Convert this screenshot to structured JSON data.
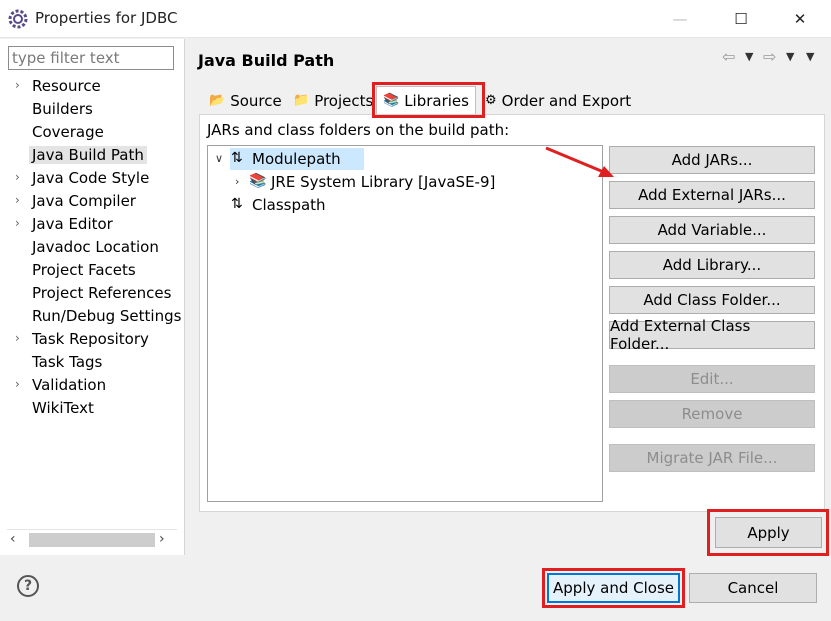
{
  "window": {
    "title": "Properties for JDBC",
    "controls": {
      "minimize": "—",
      "maximize": "☐",
      "close": "✕"
    }
  },
  "sidebar": {
    "filter_placeholder": "type filter text",
    "items": [
      {
        "label": "Resource",
        "expandable": true
      },
      {
        "label": "Builders",
        "expandable": false
      },
      {
        "label": "Coverage",
        "expandable": false
      },
      {
        "label": "Java Build Path",
        "expandable": false,
        "selected": true
      },
      {
        "label": "Java Code Style",
        "expandable": true
      },
      {
        "label": "Java Compiler",
        "expandable": true
      },
      {
        "label": "Java Editor",
        "expandable": true
      },
      {
        "label": "Javadoc Location",
        "expandable": false
      },
      {
        "label": "Project Facets",
        "expandable": false
      },
      {
        "label": "Project References",
        "expandable": false
      },
      {
        "label": "Run/Debug Settings",
        "expandable": false
      },
      {
        "label": "Task Repository",
        "expandable": true
      },
      {
        "label": "Task Tags",
        "expandable": false
      },
      {
        "label": "Validation",
        "expandable": true
      },
      {
        "label": "WikiText",
        "expandable": false
      }
    ]
  },
  "page": {
    "title": "Java Build Path",
    "tabs": [
      {
        "label": "Source",
        "icon": "source-folder-icon"
      },
      {
        "label": "Projects",
        "icon": "projects-icon"
      },
      {
        "label": "Libraries",
        "icon": "libraries-icon",
        "active": true
      },
      {
        "label": "Order and Export",
        "icon": "order-export-icon"
      }
    ],
    "content_label": "JARs and class folders on the build path:",
    "tree": {
      "modulepath": "Modulepath",
      "jre": "JRE System Library [JavaSE-9]",
      "classpath": "Classpath"
    },
    "buttons": {
      "add_jars": "Add JARs...",
      "add_external_jars": "Add External JARs...",
      "add_variable": "Add Variable...",
      "add_library": "Add Library...",
      "add_class_folder": "Add Class Folder...",
      "add_external_class_folder": "Add External Class Folder...",
      "edit": "Edit...",
      "remove": "Remove",
      "migrate_jar": "Migrate JAR File..."
    }
  },
  "footer": {
    "help": "?",
    "apply": "Apply",
    "apply_and_close": "Apply and Close",
    "cancel": "Cancel"
  },
  "colors": {
    "annotation_red": "#e02020",
    "selection_blue": "#cce8ff",
    "default_button_border": "#0078d7"
  }
}
